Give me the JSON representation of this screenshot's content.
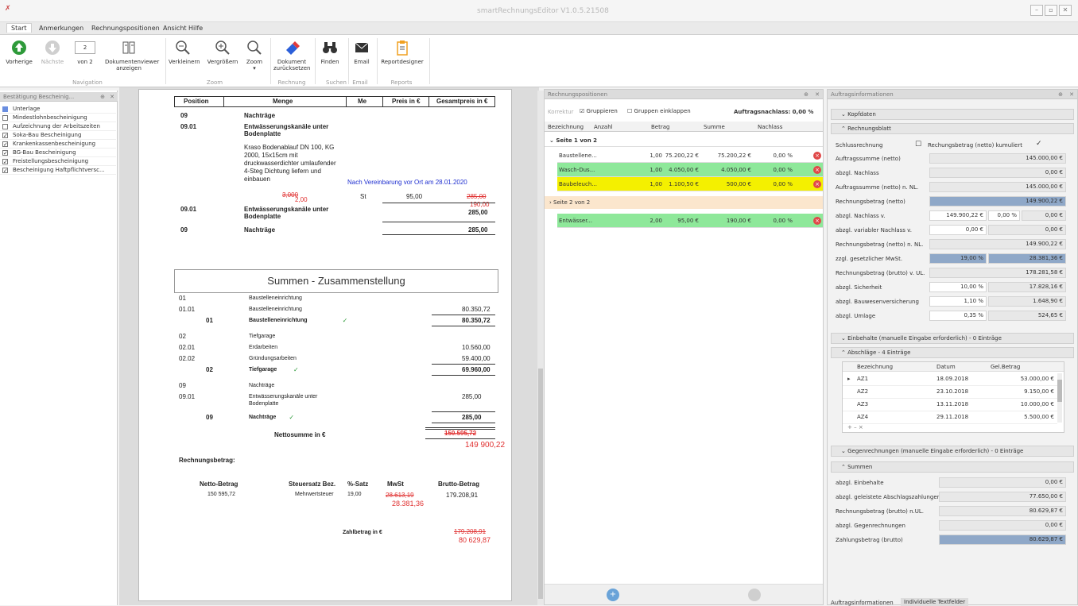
{
  "title_bar": {
    "app_title": "smartRechnungsEditor V1.0.5.21508",
    "minimize": "–",
    "restore": "▫",
    "close": "✕"
  },
  "menu": {
    "tabs": [
      "Start",
      "Anmerkungen",
      "Rechnungspositionen",
      "Ansicht",
      "Hilfe"
    ]
  },
  "ribbon": {
    "navigation": {
      "prev": "Vorherige",
      "next": "Nächste",
      "page_value": "2",
      "of_label": "von 2",
      "docviewer": "Dokumentenviewer anzeigen",
      "group": "Navigation"
    },
    "zoom": {
      "out": "Verkleinern",
      "in": "Vergrößern",
      "zoom": "Zoom",
      "group": "Zoom"
    },
    "rechnung": {
      "reset": "Dokument zurücksetzen",
      "group": "Rechnung"
    },
    "suchen": {
      "find": "Finden",
      "group": "Suchen"
    },
    "email": {
      "email": "Email",
      "group": "Email"
    },
    "reports": {
      "designer": "Reportdesigner",
      "group": "Reports"
    }
  },
  "left_panel": {
    "title": "Bestätigung Bescheinig...",
    "items": [
      {
        "label": "Unterlage",
        "checked": false
      },
      {
        "label": "Mindestlohnbescheinigung",
        "checked": false
      },
      {
        "label": "Aufzeichnung der Arbeitszeiten",
        "checked": false
      },
      {
        "label": "Soka-Bau Bescheinigung",
        "checked": true
      },
      {
        "label": "Krankenkassenbescheinigung",
        "checked": true
      },
      {
        "label": "BG-Bau Bescheinigung",
        "checked": true
      },
      {
        "label": "Freistellungsbescheinigung",
        "checked": true
      },
      {
        "label": "Bescheinigung Haftpflichtversc...",
        "checked": true
      }
    ]
  },
  "document": {
    "table_header": [
      "Position",
      "Menge",
      "Me",
      "Preis in €",
      "Gesamtpreis in €"
    ],
    "rows": {
      "r1_pos": "09",
      "r1_text": "Nachträge",
      "r2_pos": "09.01",
      "r2_text": "Entwässerungskanäle unter Bodenplatte",
      "r3_desc": "Kraso Bodenablauf DN 100, KG 2000, 15x15cm mit druckwasserdichter umlaufender 4-Steg Dichtung liefern und einbauen",
      "r3_note": "Nach Vereinbarung vor Ort am 28.01.2020",
      "r3_qty_old": "3,000",
      "r3_qty_new": "2,00",
      "r3_unit": "St",
      "r3_price": "95,00",
      "r3_total_old": "285,00",
      "r3_total_new": "190,00",
      "r4_pos": "09.01",
      "r4_text": "Entwässerungskanäle unter Bodenplatte",
      "r4_total": "285,00",
      "r5_pos": "09",
      "r5_text": "Nachträge",
      "r5_total": "285,00"
    },
    "summary_title": "Summen - Zusammenstellung",
    "summary": [
      {
        "pos": "01",
        "text": "Baustelleneinrichtung",
        "val": "",
        "bold": false
      },
      {
        "pos": "01.01",
        "text": "Baustelleneinrichtung",
        "val": "80.350,72",
        "bold": false
      },
      {
        "pos": "01",
        "text": "Baustelleneinrichtung",
        "val": "80.350,72",
        "bold": true
      },
      {
        "pos": "02",
        "text": "Tiefgarage",
        "val": "",
        "bold": false
      },
      {
        "pos": "02.01",
        "text": "Erdarbeiten",
        "val": "10.560,00",
        "bold": false
      },
      {
        "pos": "02.02",
        "text": "Gründungsarbeiten",
        "val": "59.400,00",
        "bold": false
      },
      {
        "pos": "02",
        "text": "Tiefgarage",
        "val": "69.960,00",
        "bold": true
      },
      {
        "pos": "09",
        "text": "Nachträge",
        "val": "",
        "bold": false
      },
      {
        "pos": "09.01",
        "text": "Entwässerungskanäle unter Bodenplatte",
        "val": "285,00",
        "bold": false
      },
      {
        "pos": "09",
        "text": "Nachträge",
        "val": "285,00",
        "bold": true
      }
    ],
    "netto_label": "Nettosumme in €",
    "netto_old": "150.595,72",
    "netto_new": "149 900,22",
    "rechnungsbetrag": "Rechnungsbetrag:",
    "tax_headers": [
      "Netto-Betrag",
      "Steuersatz Bez.",
      "%-Satz",
      "MwSt",
      "Brutto-Betrag"
    ],
    "tax_row": {
      "netto": "150 595,72",
      "bez": "Mehrwertsteuer",
      "satz": "19,00",
      "mwst_old": "28.613,19",
      "mwst_new": "28.381,36",
      "brutto": "179.208,91"
    },
    "zahl_label": "Zahlbetrag in €",
    "zahl_old": "179.208,91",
    "zahl_new": "80 629,87"
  },
  "mid_panel": {
    "title": "Rechnungspositionen",
    "korrektur": "Korrektur",
    "gruppieren": "Gruppieren",
    "einklappen": "Gruppen einklappen",
    "nachlass": "Auftragsnachlass: 0,00 %",
    "columns": [
      "Bezeichnung",
      "Anzahl",
      "Betrag",
      "Summe",
      "Nachlass"
    ],
    "group1": "Seite 1 von 2",
    "group2": "Seite 2 von 2",
    "rows": [
      {
        "name": "Baustellene...",
        "anzahl": "1,00",
        "betrag": "75.200,22 €",
        "summe": "75.200,22 €",
        "nachlass": "0,00 %",
        "color": "#ffffff"
      },
      {
        "name": "Wasch-Dus...",
        "anzahl": "1,00",
        "betrag": "4.050,00 €",
        "summe": "4.050,00 €",
        "nachlass": "0,00 %",
        "color": "#8ee89a"
      },
      {
        "name": "Baubeleuch...",
        "anzahl": "1,00",
        "betrag": "1.100,50 €",
        "summe": "500,00 €",
        "nachlass": "0,00 %",
        "color": "#f4f000"
      },
      {
        "name": "Entwässer...",
        "anzahl": "2,00",
        "betrag": "95,00 €",
        "summe": "190,00 €",
        "nachlass": "0,00 %",
        "color": "#8ee89a"
      }
    ]
  },
  "right_panel": {
    "title": "Auftragsinformationen",
    "kopfdaten": "Kopfdaten",
    "rechnungsblatt": "Rechnungsblatt",
    "schluss": "Schlussrechnung",
    "kumuliert": "Rechungsbetrag (netto) kumuliert",
    "fields": [
      {
        "label": "Auftragssumme (netto)",
        "v": "145.000,00 €"
      },
      {
        "label": "abzgl. Nachlass",
        "v": "0,00 €"
      },
      {
        "label": "Auftragssumme (netto) n. NL.",
        "v": "145.000,00 €"
      },
      {
        "label": "Rechnungsbetrag (netto)",
        "v": "149.900,22 €"
      },
      {
        "label": "abzgl. Nachlass v.",
        "v1": "149.900,22 €",
        "v2": "0,00 %",
        "v": "0,00 €"
      },
      {
        "label": "abzgl. variabler Nachlass v.",
        "v1": "0,00 €",
        "v": "0,00 €"
      },
      {
        "label": "Rechnungsbetrag (netto) n. NL.",
        "v": "149.900,22 €"
      },
      {
        "label": "zzgl. gesetzlicher MwSt.",
        "v1": "19,00 %",
        "v": "28.381,36 €"
      },
      {
        "label": "Rechnungsbetrag (brutto) v. UL.",
        "v": "178.281,58 €"
      },
      {
        "label": "abzgl. Sicherheit",
        "v1": "10,00 %",
        "v": "17.828,16 €"
      },
      {
        "label": "abzgl. Bauwesenversicherung",
        "v1": "1,10 %",
        "v": "1.648,90 €"
      },
      {
        "label": "abzgl. Umlage",
        "v1": "0,35 %",
        "v": "524,65 €"
      }
    ],
    "einbehalte": "Einbehalte (manuelle Eingabe erforderlich) - 0 Einträge",
    "abschlaege": "Abschläge - 4 Einträge",
    "ab_cols": [
      "Bezeichnung",
      "Datum",
      "Gel.Betrag"
    ],
    "ab_rows": [
      {
        "b": "AZ1",
        "d": "18.09.2018",
        "g": "53.000,00 €"
      },
      {
        "b": "AZ2",
        "d": "23.10.2018",
        "g": "9.150,00 €"
      },
      {
        "b": "AZ3",
        "d": "13.11.2018",
        "g": "10.000,00 €"
      },
      {
        "b": "AZ4",
        "d": "29.11.2018",
        "g": "5.500,00 €"
      }
    ],
    "ab_controls": "+ – ×",
    "gegen": "Gegenrechnungen (manuelle Eingabe erforderlich) - 0 Einträge",
    "summen": "Summen",
    "sums": [
      {
        "label": "abzgl. Einbehalte",
        "v": "0,00 €"
      },
      {
        "label": "abzgl. geleistete Abschlagszahlungen",
        "v": "77.650,00 €"
      },
      {
        "label": "Rechnungsbetrag (brutto) n.UL.",
        "v": "80.629,87 €"
      },
      {
        "label": "abzgl. Gegenrechnungen",
        "v": "0,00 €"
      },
      {
        "label": "Zahlungsbetrag (brutto)",
        "v": "80.629,87 €"
      }
    ],
    "bottom_tabs": [
      "Auftragsinformationen",
      "Individuelle Textfelder"
    ]
  },
  "colors": {
    "accent_green": "#2e9a3a",
    "blue_highlight": "#8fa8c8",
    "red_correction": "#e03030"
  }
}
